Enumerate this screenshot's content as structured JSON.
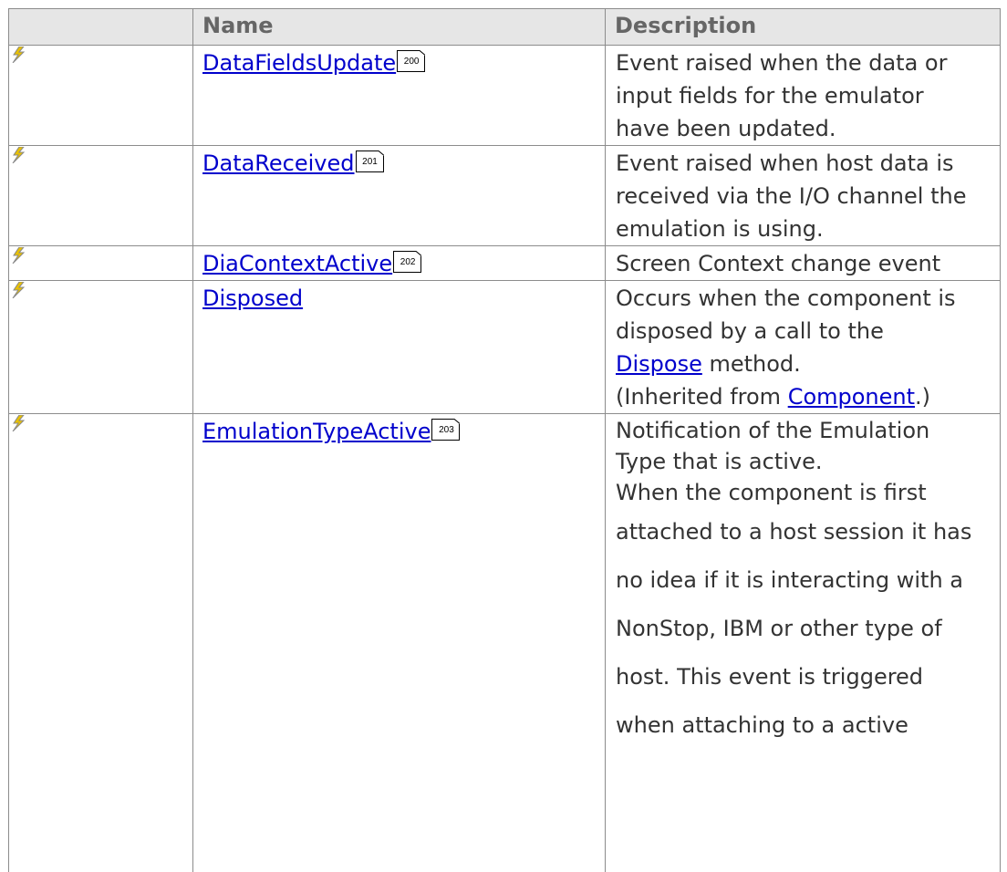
{
  "table": {
    "headers": {
      "icon": "",
      "name": "Name",
      "description": "Description"
    },
    "icon_name": "event-lightning-icon",
    "rows": [
      {
        "name": "DataFieldsUpdate",
        "page_ref": "200",
        "description": [
          "Event raised when the data or",
          "input fields for the emulator",
          "have been updated."
        ]
      },
      {
        "name": "DataReceived",
        "page_ref": "201",
        "description": [
          "Event raised when host data is",
          "received via the I/O channel the",
          "emulation is using."
        ]
      },
      {
        "name": "DiaContextActive",
        "page_ref": "202",
        "description": [
          "Screen Context change event"
        ]
      },
      {
        "name": "Disposed",
        "page_ref": "",
        "description_line1": "Occurs when the component is",
        "description_line2": "disposed by a call to the",
        "dispose_link": "Dispose",
        "method_text": " method.",
        "inherited_prefix": "(Inherited from ",
        "component_link": "Component",
        "inherited_suffix": ".)"
      },
      {
        "name": "EmulationTypeActive",
        "page_ref": "203",
        "description_a": [
          "Notification of the Emulation",
          "Type that is active.",
          "When the component is first"
        ],
        "description_b": [
          "attached to a host session it has",
          "no idea if it is interacting with a",
          "NonStop, IBM or other type of",
          "host. This event is triggered",
          "when attaching to a active"
        ]
      }
    ]
  }
}
